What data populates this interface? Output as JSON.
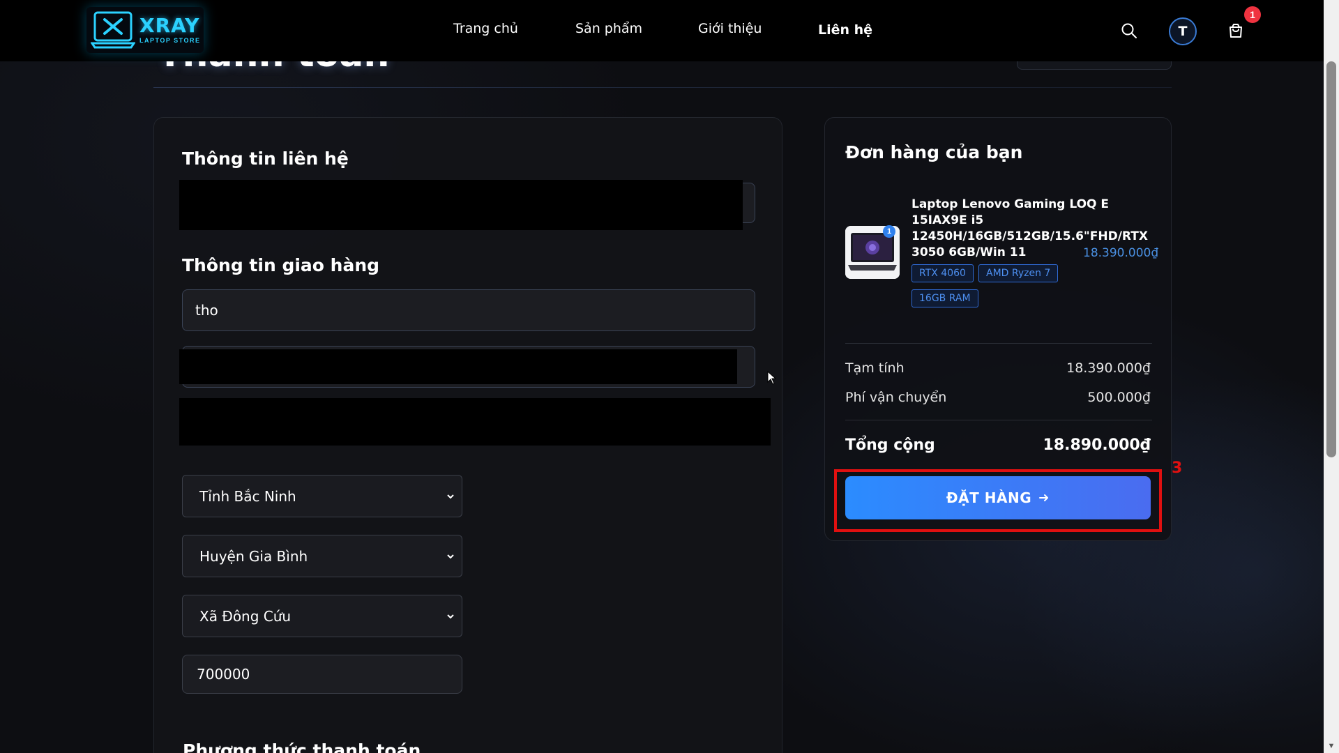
{
  "header": {
    "logo_title": "XRAY",
    "logo_subtitle": "LAPTOP STORE",
    "nav": [
      {
        "label": "Trang chủ"
      },
      {
        "label": "Sản phẩm"
      },
      {
        "label": "Giới thiệu"
      },
      {
        "label": "Liên hệ",
        "active": true
      }
    ],
    "avatar_initial": "T",
    "cart_count": "1",
    "icons": {
      "search": "search-icon",
      "cart": "shopping-bag-icon"
    },
    "accent_color": "#2bd2ff"
  },
  "page": {
    "title": "Thanh toán"
  },
  "checkout_form": {
    "contact_title": "Thông tin liên hệ",
    "shipping_title": "Thông tin giao hàng",
    "name_value": "tho",
    "province": "Tỉnh Bắc Ninh",
    "district": "Huyện Gia Bình",
    "ward": "Xã Đông Cứu",
    "postal_code": "700000",
    "payment_title": "Phương thức thanh toán"
  },
  "order": {
    "title": "Đơn hàng của bạn",
    "item": {
      "name": "Laptop Lenovo Gaming LOQ E 15IAX9E i5 12450H/16GB/512GB/15.6\"FHD/RTX 3050 6GB/Win 11",
      "quantity": "1",
      "price": "18.390.000₫",
      "tags": [
        "RTX 4060",
        "AMD Ryzen 7",
        "16GB RAM"
      ]
    },
    "subtotal_label": "Tạm tính",
    "subtotal_value": "18.390.000₫",
    "shipping_label": "Phí vận chuyển",
    "shipping_value": "500.000₫",
    "total_label": "Tổng cộng",
    "total_value": "18.890.000₫",
    "submit_label": "ĐẶT HÀNG",
    "submit_color": "#2b8cff"
  },
  "annotation": {
    "label": "3",
    "color": "#e01010"
  }
}
